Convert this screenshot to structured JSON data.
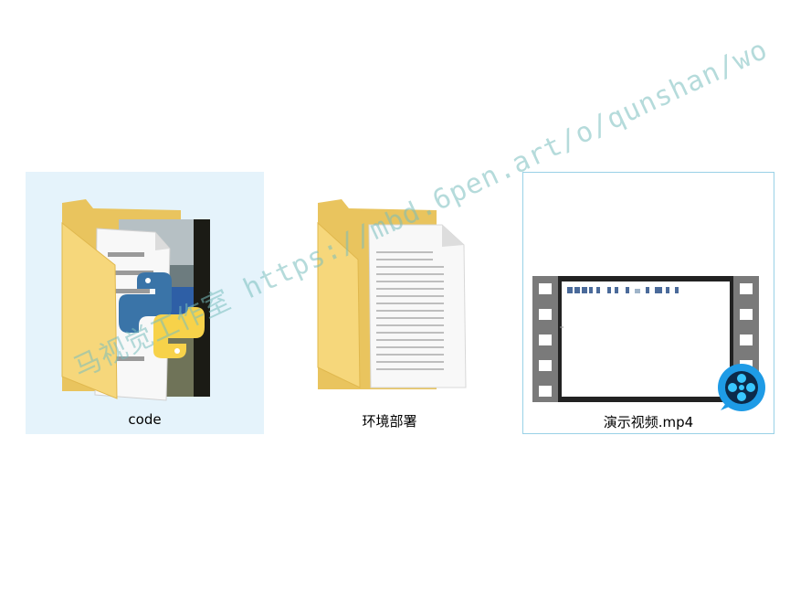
{
  "files": [
    {
      "name": "code",
      "type": "folder",
      "thumbnail": "python-folder-icon",
      "selected": true
    },
    {
      "name": "环境部署",
      "type": "folder",
      "thumbnail": "document-folder-icon",
      "selected": false
    },
    {
      "name": "演示视频.mp4",
      "type": "video",
      "thumbnail": "video-filmstrip-icon",
      "focused": true
    }
  ],
  "watermark": {
    "text": "马视觉工作室 https://mbd.6pen.art/o/qunshan/wo"
  },
  "colors": {
    "selection_bg": "#e5f3fb",
    "focus_border": "#99d1e6",
    "folder_yellow": "#f6d77b",
    "python_blue": "#3a74a8",
    "python_yellow": "#f7d24a",
    "player_badge": "#1e9be6"
  }
}
